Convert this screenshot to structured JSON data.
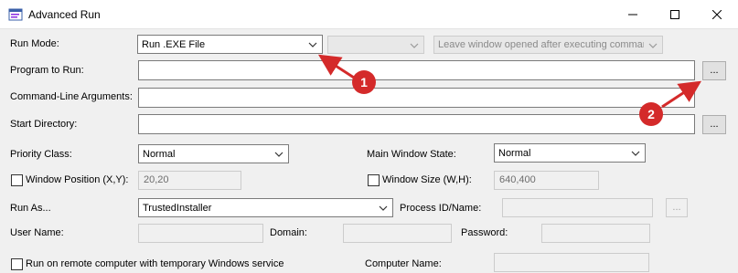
{
  "window": {
    "title": "Advanced Run",
    "minimize_icon": "minimize-icon",
    "maximize_icon": "maximize-icon",
    "close_icon": "close-icon"
  },
  "run_mode": {
    "label": "Run Mode:",
    "selected": "Run .EXE File",
    "secondary_selected": "",
    "leave_window_selected": "Leave window opened after executing command"
  },
  "program": {
    "label": "Program to Run:",
    "value": "",
    "browse_label": "..."
  },
  "args": {
    "label": "Command-Line Arguments:",
    "value": ""
  },
  "start_dir": {
    "label": "Start Directory:",
    "value": "",
    "browse_label": "..."
  },
  "priority": {
    "label": "Priority Class:",
    "selected": "Normal"
  },
  "main_window_state": {
    "label": "Main Window State:",
    "selected": "Normal"
  },
  "window_position": {
    "label": "Window Position (X,Y):",
    "value": "20,20",
    "checked": false
  },
  "window_size": {
    "label": "Window Size (W,H):",
    "value": "640,400",
    "checked": false
  },
  "run_as": {
    "label": "Run As...",
    "selected": "TrustedInstaller"
  },
  "process_id": {
    "label": "Process ID/Name:",
    "value": "",
    "browse_label": "..."
  },
  "user_name": {
    "label": "User Name:",
    "value": ""
  },
  "domain": {
    "label": "Domain:",
    "value": ""
  },
  "password": {
    "label": "Password:",
    "value": ""
  },
  "remote": {
    "label": "Run on remote computer with temporary Windows service",
    "checked": false
  },
  "computer_name": {
    "label": "Computer Name:",
    "value": ""
  },
  "annotations": {
    "badge_1": "1",
    "badge_2": "2"
  },
  "colors": {
    "annotation": "#d42a2a",
    "window_bg": "#f0f0f0"
  }
}
